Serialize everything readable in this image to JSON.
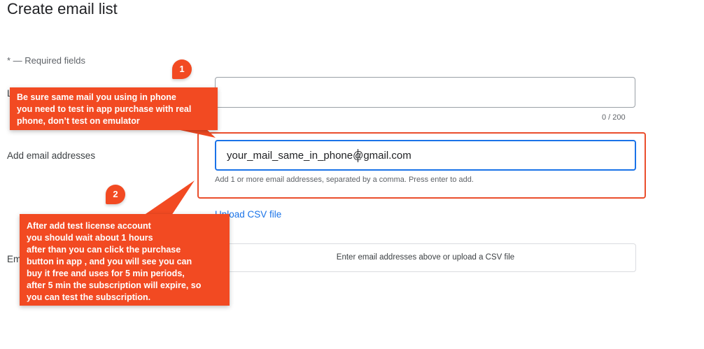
{
  "page": {
    "title": "Create email list",
    "required_note": "* — Required fields",
    "list_name_label_partial": "L",
    "list_name_counter": "0 / 200",
    "add_email_label": "Add email addresses",
    "email_input_value": "your_mail_same_in_phone@gmail.com",
    "email_hint": "Add 1 or more email addresses, separated by a comma. Press enter to add.",
    "upload_csv_link": "Upload CSV file",
    "emails_label_partial": "Em",
    "emails_placeholder": "Enter email addresses above or upload a CSV file"
  },
  "annotations": {
    "badge_1": "1",
    "badge_2": "2",
    "callout_1": [
      "Be sure same mail you using in phone",
      "you need to test in app purchase with real",
      "phone, don’t test on emulator"
    ],
    "callout_2": [
      "After add test license account",
      "you should wait about 1 hours",
      "after than you can click the purchase",
      "button in app , and you will see you can",
      "buy it free and uses for 5 min periods,",
      "after 5 min the subscription will expire, so",
      "you can test the subscription."
    ],
    "color": "#f24a22"
  },
  "colors": {
    "focus_blue": "#1a73e8",
    "link_blue": "#1a73e8",
    "highlight_red": "#ea4e2c"
  }
}
